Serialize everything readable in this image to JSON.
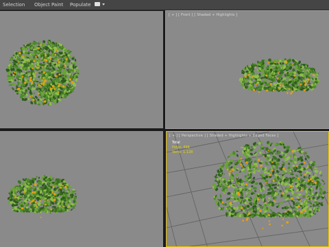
{
  "menubar": {
    "items": [
      "Selection",
      "Object Paint",
      "Populate"
    ],
    "dropdown_icon": "teapot-dropdown-icon"
  },
  "viewports": {
    "top_left": {
      "label": ""
    },
    "top_right": {
      "label": "[ + ] [ Front ] [ Shaded + Highlights ]"
    },
    "bottom_left": {
      "label": ""
    },
    "bottom_right": {
      "label": "[ + ] [ Perspective ] [ Shaded + Highlights + Edged Faces ]",
      "stats": {
        "total_label": "Total",
        "polys_label": "Polys:",
        "polys_value": "496",
        "verts_label": "Verts:",
        "verts_value": "1,128"
      }
    }
  },
  "colors": {
    "viewport_bg": "#8a8a8a",
    "active_border": "#e8c400",
    "foliage_dark": "#2e5a1c",
    "foliage_mid": "#4f8a2a",
    "foliage_light": "#8fbf4a",
    "flower": "#e8a010"
  }
}
